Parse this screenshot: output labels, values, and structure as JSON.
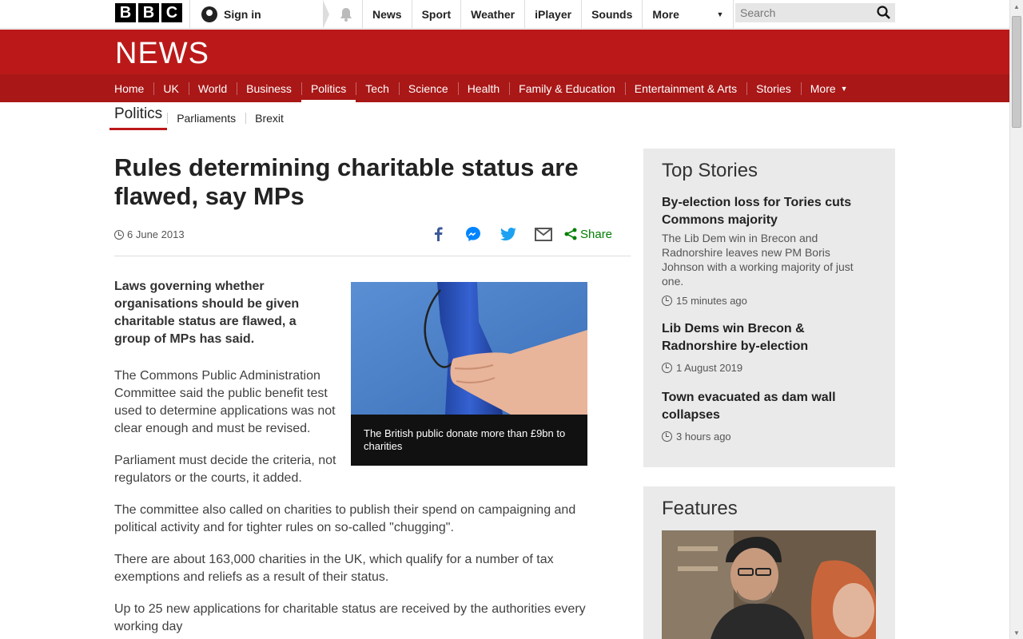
{
  "topbar": {
    "logo_letters": [
      "B",
      "B",
      "C"
    ],
    "signin": "Sign in",
    "nav": [
      "News",
      "Sport",
      "Weather",
      "iPlayer",
      "Sounds"
    ],
    "more": "More",
    "search_placeholder": "Search"
  },
  "news": {
    "logo": "NEWS",
    "sections": [
      "Home",
      "UK",
      "World",
      "Business",
      "Politics",
      "Tech",
      "Science",
      "Health",
      "Family & Education",
      "Entertainment & Arts",
      "Stories"
    ],
    "sections_more": "More",
    "active_section": "Politics"
  },
  "subnav": {
    "title": "Politics",
    "links": [
      "Parliaments",
      "Brexit"
    ]
  },
  "article": {
    "headline": "Rules determining charitable status are flawed, say MPs",
    "date": "6 June 2013",
    "share_label": "Share",
    "lead": "Laws governing whether organisations should be given charitable status are flawed, a group of MPs has said.",
    "paragraphs": [
      "The Commons Public Administration Committee said the public benefit test used to determine applications was not clear enough and must be revised.",
      "Parliament must decide the criteria, not regulators or the courts, it added.",
      "The committee also called on charities to publish their spend on campaigning and political activity and for tighter rules on so-called \"chugging\".",
      "There are about 163,000 charities in the UK, which qualify for a number of tax exemptions and reliefs as a result of their status.",
      "Up to 25 new applications for charitable status are received by the authorities every working day"
    ],
    "image_caption": "The British public donate more than £9bn to charities"
  },
  "top_stories": {
    "title": "Top Stories",
    "items": [
      {
        "title": "By-election loss for Tories cuts Commons majority",
        "summary": "The Lib Dem win in Brecon and Radnorshire leaves new PM Boris Johnson with a working majority of just one.",
        "time": "15 minutes ago"
      },
      {
        "title": "Lib Dems win Brecon & Radnorshire by-election",
        "summary": "",
        "time": "1 August 2019"
      },
      {
        "title": "Town evacuated as dam wall collapses",
        "summary": "",
        "time": "3 hours ago"
      }
    ]
  },
  "features": {
    "title": "Features"
  },
  "colors": {
    "brand_red": "#bb1919",
    "nav_red": "#a91717",
    "share_green": "#007f00"
  }
}
